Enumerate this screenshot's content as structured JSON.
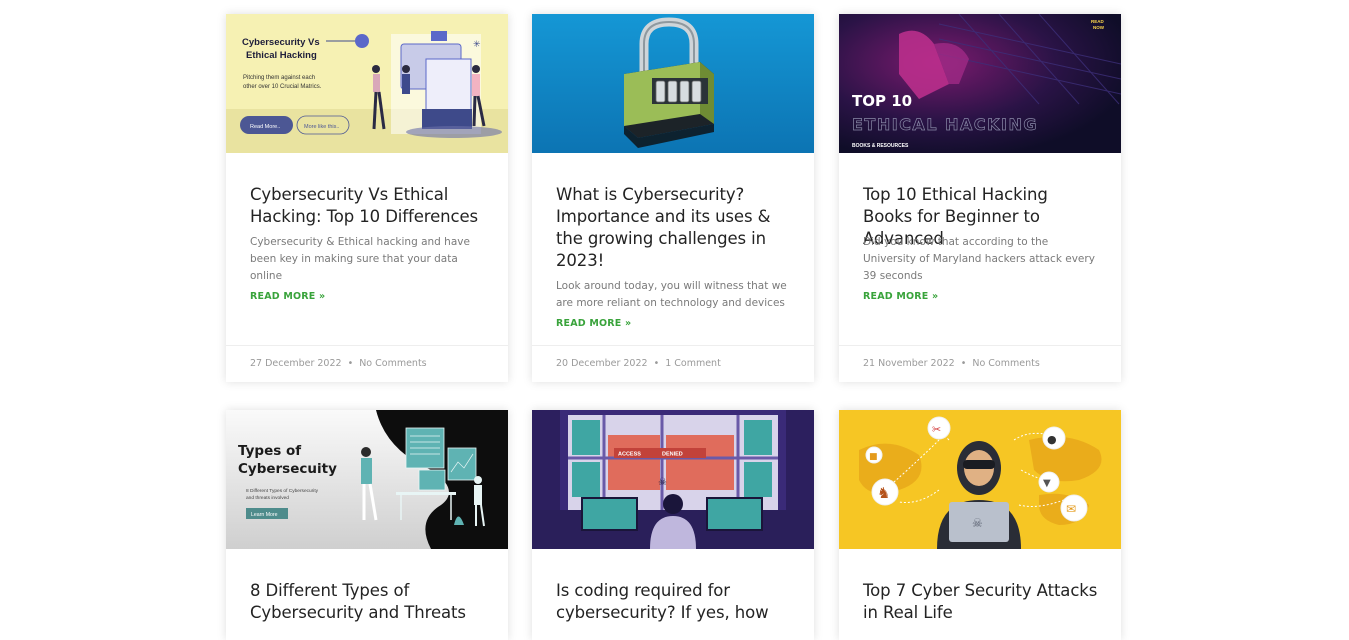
{
  "posts": [
    {
      "title": "Cybersecurity Vs Ethical Hacking: Top 10 Differences",
      "excerpt": "Cybersecurity & Ethical hacking and have been key in making sure that your data online",
      "read_more": "READ MORE »",
      "date": "27 December 2022",
      "comments": "No Comments",
      "image": {
        "heading_line1": "Cybersecurity Vs",
        "heading_line2": "Ethical Hacking",
        "sub_line1": "Pitching them against each",
        "sub_line2": "other over 10 Crucial Matrics.",
        "button1": "Read More..",
        "button2": "More like this.."
      }
    },
    {
      "title": "What is Cybersecurity? Importance and its uses & the growing challenges in 2023!",
      "excerpt": "Look around today, you will witness that we are more reliant on technology and devices",
      "read_more": "READ MORE »",
      "date": "20 December 2022",
      "comments": "1 Comment"
    },
    {
      "title": "Top 10 Ethical Hacking Books for Beginner to Advanced",
      "excerpt": "Did you know that according to the University of Maryland hackers attack every 39 seconds",
      "read_more": "READ MORE »",
      "date": "21 November 2022",
      "comments": "No Comments",
      "image": {
        "heading": "TOP 10",
        "subheading": "ETHICAL HACKING",
        "badge_line1": "READ",
        "badge_line2": "NOW",
        "caption": "BOOKS & RESOURCES"
      }
    },
    {
      "title": "8 Different Types of Cybersecurity and Threats",
      "image": {
        "heading_line1": "Types of",
        "heading_line2": "Cybersecuity",
        "sub_line1": "8 Different Types of Cybersecurity",
        "sub_line2": "and threats involved",
        "button": "Learn More"
      }
    },
    {
      "title": "Is coding required for cybersecurity? If yes, how",
      "image": {
        "alert_left": "ACCESS",
        "alert_right": "DENIED"
      }
    },
    {
      "title": "Top 7 Cyber Security Attacks in Real Life"
    }
  ]
}
